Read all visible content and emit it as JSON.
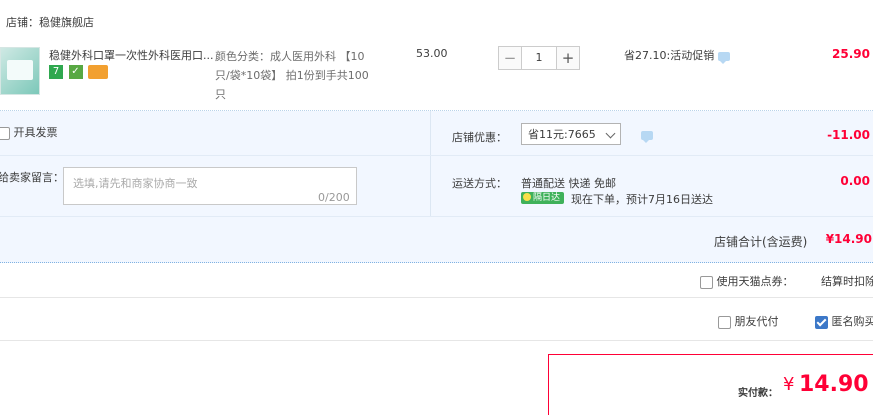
{
  "store": {
    "label": "店铺：稳健旗舰店"
  },
  "item": {
    "title": "稳健外科口罩一次性外科医用口...",
    "badges": [
      "7"
    ],
    "sku_lines": [
      "颜色分类：成人医用外科 【10",
      "只/袋*10袋】 拍1份到手共100",
      "只"
    ],
    "unit_price": "53.00",
    "quantity": "1",
    "minus": "−",
    "plus": "+",
    "promo": "省27.10:活动促销",
    "subtotal": "25.90"
  },
  "invoice": {
    "label": "开具发票"
  },
  "shop_discount": {
    "label": "店铺优惠：",
    "selected": "省11元:7665",
    "value": "-11.00"
  },
  "message": {
    "label": "给卖家留言：",
    "placeholder": "选填,请先和商家协商一致",
    "count": "0/200"
  },
  "shipping": {
    "label": "运送方式：",
    "method": "普通配送 快递 免邮",
    "badge": "隔日达",
    "eta": "现在下单，预计7月16日送达",
    "value": "0.00"
  },
  "store_total": {
    "label": "店铺合计(含运费)",
    "value": "¥14.90"
  },
  "tmall_points": {
    "label": "使用天猫点券：",
    "note": "结算时扣除"
  },
  "friend_pay": {
    "label": "朋友代付"
  },
  "anonymous": {
    "label": "匿名购买"
  },
  "payment": {
    "label": "实付款：",
    "currency": "¥",
    "amount": "14.90"
  },
  "colors": {
    "accent": "#ff0036",
    "panel": "#f2f7ff",
    "link": "#3c78c8"
  }
}
